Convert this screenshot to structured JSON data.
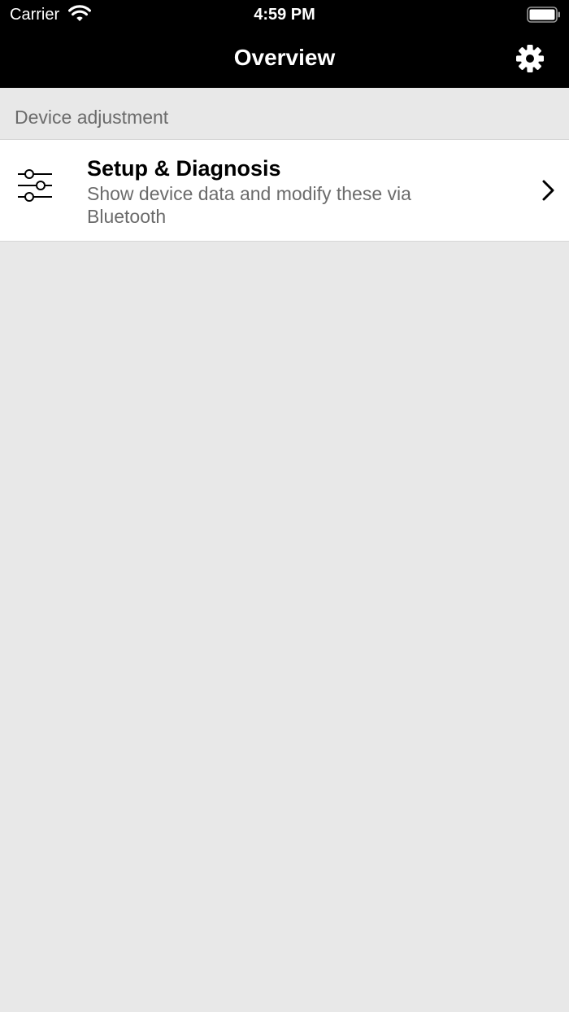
{
  "status_bar": {
    "carrier": "Carrier",
    "time": "4:59 PM",
    "wifi_icon": "wifi-icon",
    "battery_icon": "battery-icon"
  },
  "nav_bar": {
    "title": "Overview",
    "settings_icon": "gear-icon"
  },
  "section": {
    "header": "Device adjustment",
    "items": [
      {
        "icon": "sliders-icon",
        "title": "Setup & Diagnosis",
        "subtitle": "Show device data and modify these via Bluetooth",
        "accessory_icon": "chevron-right-icon"
      }
    ]
  },
  "colors": {
    "bar_background": "#000000",
    "bar_text": "#ffffff",
    "page_background": "#e8e8e8",
    "secondary_text": "#6b6b6b"
  }
}
